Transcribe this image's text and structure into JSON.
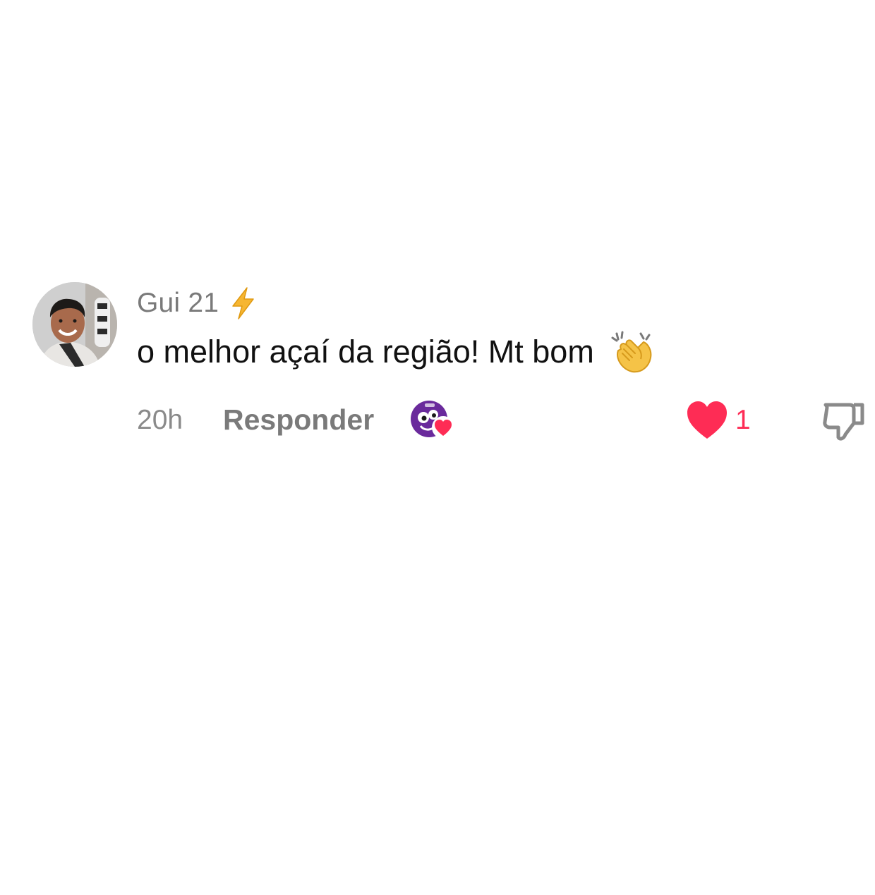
{
  "comment": {
    "username": "Gui 21",
    "username_badge_icon": "lightning-bolt-icon",
    "text": "o melhor açaí da região! Mt bom",
    "text_emoji_icon": "clapping-hands-icon",
    "timestamp": "20h",
    "reply_label": "Responder",
    "creator_liked_icon": "creator-avatar-heart-icon",
    "like_icon": "heart-icon",
    "like_count": "1",
    "dislike_icon": "thumbs-down-icon"
  },
  "colors": {
    "like_red": "#fe2c55",
    "muted_gray": "#7a7a7a",
    "text_black": "#111111",
    "creator_purple": "#6a2a9c"
  }
}
